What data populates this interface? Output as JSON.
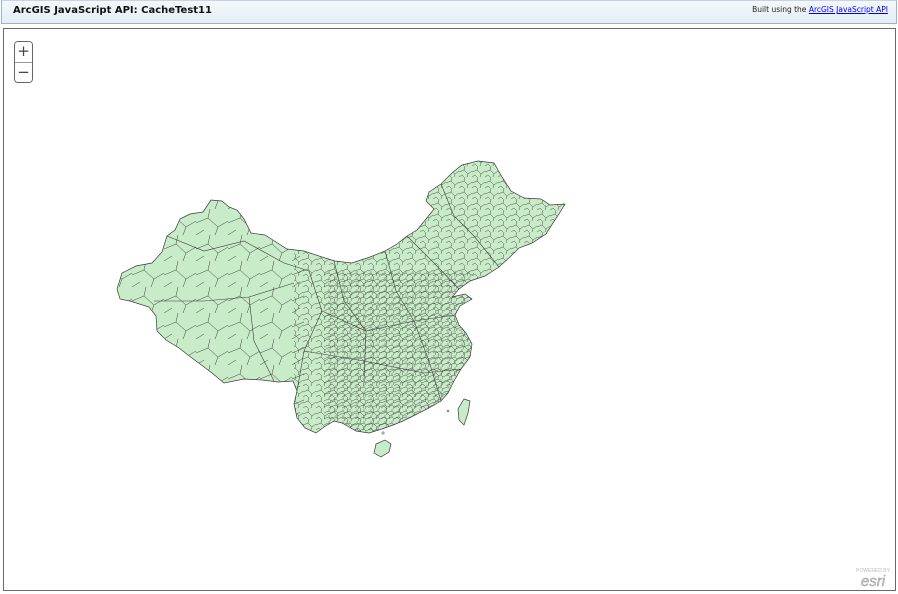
{
  "header": {
    "title": "ArcGIS JavaScript API: CacheTest11",
    "credit_prefix": "Built using the",
    "credit_link": "ArcGIS JavaScript API"
  },
  "map": {
    "zoom_in_label": "+",
    "zoom_out_label": "−",
    "region_fill": "#c8ecc8",
    "border_color": "#3a3a3a",
    "logo": "esri-logo"
  }
}
